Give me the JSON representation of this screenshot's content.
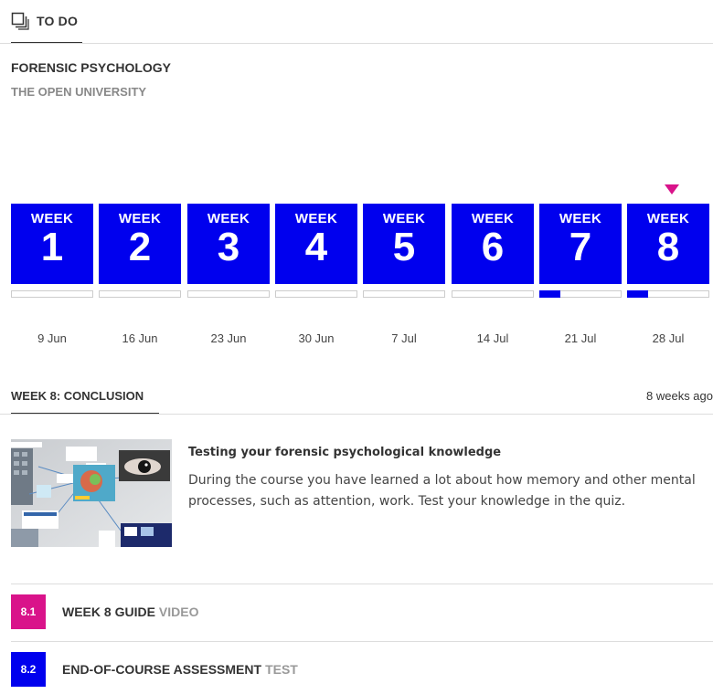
{
  "header": {
    "tab_label": "TO DO"
  },
  "course": {
    "title": "FORENSIC PSYCHOLOGY",
    "provider": "THE OPEN UNIVERSITY"
  },
  "colors": {
    "week_blue": "#0000ee",
    "accent_pink": "#d9138a"
  },
  "current_week": 8,
  "weeks": [
    {
      "word": "WEEK",
      "number": "1",
      "date": "9 Jun",
      "progress": 0
    },
    {
      "word": "WEEK",
      "number": "2",
      "date": "16 Jun",
      "progress": 0
    },
    {
      "word": "WEEK",
      "number": "3",
      "date": "23 Jun",
      "progress": 0
    },
    {
      "word": "WEEK",
      "number": "4",
      "date": "30 Jun",
      "progress": 0
    },
    {
      "word": "WEEK",
      "number": "5",
      "date": "7 Jul",
      "progress": 0
    },
    {
      "word": "WEEK",
      "number": "6",
      "date": "14 Jul",
      "progress": 0
    },
    {
      "word": "WEEK",
      "number": "7",
      "date": "21 Jul",
      "progress": 0.25
    },
    {
      "word": "WEEK",
      "number": "8",
      "date": "28 Jul",
      "progress": 0.25
    }
  ],
  "week_section": {
    "heading": "WEEK 8: CONCLUSION",
    "time_ago": "8 weeks ago"
  },
  "feature": {
    "title": "Testing your forensic psychological knowledge",
    "description": "During the course you have learned a lot about how memory and other mental processes, such as attention, work. Test your knowledge in the quiz."
  },
  "steps": [
    {
      "number": "8.1",
      "title": "WEEK 8 GUIDE",
      "type": "VIDEO",
      "color": "#d9138a"
    },
    {
      "number": "8.2",
      "title": "END-OF-COURSE ASSESSMENT",
      "type": "TEST",
      "color": "#0000ee"
    }
  ]
}
